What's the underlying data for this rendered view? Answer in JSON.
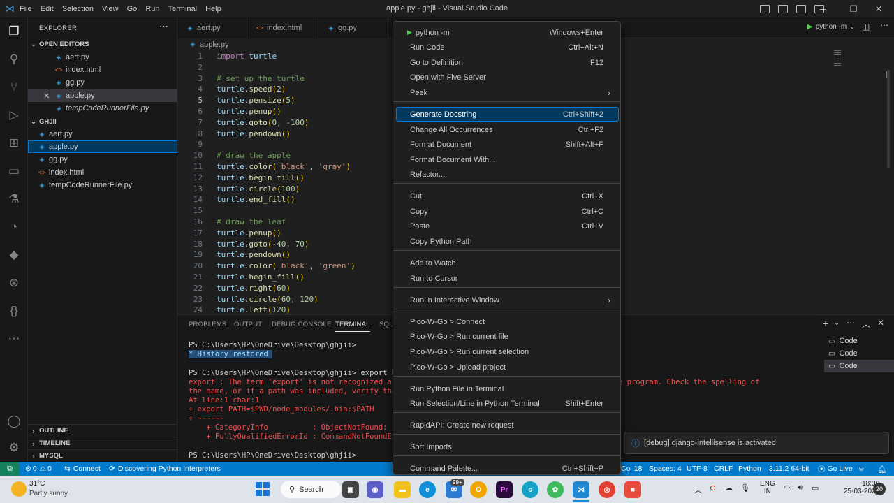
{
  "window": {
    "title": "apple.py - ghjii - Visual Studio Code",
    "menu": [
      "File",
      "Edit",
      "Selection",
      "View",
      "Go",
      "Run",
      "Terminal",
      "Help"
    ]
  },
  "sidebar": {
    "header": "EXPLORER",
    "open_editors_label": "OPEN EDITORS",
    "open_editors": [
      {
        "name": "aert.py",
        "type": "py"
      },
      {
        "name": "index.html",
        "type": "html"
      },
      {
        "name": "gg.py",
        "type": "py"
      },
      {
        "name": "apple.py",
        "type": "py"
      },
      {
        "name": "tempCodeRunnerFile.py",
        "type": "py"
      }
    ],
    "folder_label": "GHJII",
    "files": [
      {
        "name": "aert.py",
        "type": "py"
      },
      {
        "name": "apple.py",
        "type": "py"
      },
      {
        "name": "gg.py",
        "type": "py"
      },
      {
        "name": "index.html",
        "type": "html"
      },
      {
        "name": "tempCodeRunnerFile.py",
        "type": "py"
      }
    ],
    "outline_label": "OUTLINE",
    "timeline_label": "TIMELINE",
    "mysql_label": "MYSQL"
  },
  "tabs": [
    {
      "label": "aert.py",
      "type": "py"
    },
    {
      "label": "index.html",
      "type": "html"
    },
    {
      "label": "gg.py",
      "type": "py"
    }
  ],
  "run_label": "python -m",
  "breadcrumb": "apple.py",
  "code_lines": [
    {
      "n": "1",
      "t": "import turtle"
    },
    {
      "n": "2",
      "t": ""
    },
    {
      "n": "3",
      "t": "# set up the turtle"
    },
    {
      "n": "4",
      "t": "turtle.speed(2)"
    },
    {
      "n": "5",
      "t": "turtle.pensize(5)"
    },
    {
      "n": "6",
      "t": "turtle.penup()"
    },
    {
      "n": "7",
      "t": "turtle.goto(0, -100)"
    },
    {
      "n": "8",
      "t": "turtle.pendown()"
    },
    {
      "n": "9",
      "t": ""
    },
    {
      "n": "10",
      "t": "# draw the apple"
    },
    {
      "n": "11",
      "t": "turtle.color('black', 'gray')"
    },
    {
      "n": "12",
      "t": "turtle.begin_fill()"
    },
    {
      "n": "13",
      "t": "turtle.circle(100)"
    },
    {
      "n": "14",
      "t": "turtle.end_fill()"
    },
    {
      "n": "15",
      "t": ""
    },
    {
      "n": "16",
      "t": "# draw the leaf"
    },
    {
      "n": "17",
      "t": "turtle.penup()"
    },
    {
      "n": "18",
      "t": "turtle.goto(-40, 70)"
    },
    {
      "n": "19",
      "t": "turtle.pendown()"
    },
    {
      "n": "20",
      "t": "turtle.color('black', 'green')"
    },
    {
      "n": "21",
      "t": "turtle.begin_fill()"
    },
    {
      "n": "22",
      "t": "turtle.right(60)"
    },
    {
      "n": "23",
      "t": "turtle.circle(60, 120)"
    },
    {
      "n": "24",
      "t": "turtle.left(120)"
    }
  ],
  "panel": {
    "tabs": [
      "PROBLEMS",
      "OUTPUT",
      "DEBUG CONSOLE",
      "TERMINAL",
      "SQL"
    ],
    "active_tab": "TERMINAL",
    "terminal": {
      "prompt1": "PS C:\\Users\\HP\\OneDrive\\Desktop\\ghjii>",
      "history": " History restored ",
      "prompt2": "PS C:\\Users\\HP\\OneDrive\\Desktop\\ghjii> export PAT",
      "err1": "export : The term 'export' is not recognized as t",
      "err1b": "e program. Check the spelling of",
      "err2": "the name, or if a path was included, verify that",
      "err3": "At line:1 char:1",
      "err4": "+ export PATH=$PWD/node_modules/.bin:$PATH",
      "err5": "+ ~~~~~~",
      "err6": "    + CategoryInfo          : ObjectNotFound: (ex",
      "err7": "    + FullyQualifiedErrorId : CommandNotFoundExce",
      "prompt3": "PS C:\\Users\\HP\\OneDrive\\Desktop\\ghjii>"
    },
    "terminals": [
      "Code",
      "Code",
      "Code"
    ]
  },
  "context_menu": [
    {
      "label": "python -m",
      "key": "Windows+Enter"
    },
    {
      "label": "Run Code",
      "key": "Ctrl+Alt+N"
    },
    {
      "label": "Go to Definition",
      "key": "F12"
    },
    {
      "label": "Open with Five Server",
      "key": ""
    },
    {
      "label": "Peek",
      "key": ""
    },
    {
      "label": "Generate Docstring",
      "key": "Ctrl+Shift+2"
    },
    {
      "label": "Change All Occurrences",
      "key": "Ctrl+F2"
    },
    {
      "label": "Format Document",
      "key": "Shift+Alt+F"
    },
    {
      "label": "Format Document With...",
      "key": ""
    },
    {
      "label": "Refactor...",
      "key": ""
    },
    {
      "label": "Cut",
      "key": "Ctrl+X"
    },
    {
      "label": "Copy",
      "key": "Ctrl+C"
    },
    {
      "label": "Paste",
      "key": "Ctrl+V"
    },
    {
      "label": "Copy Python Path",
      "key": ""
    },
    {
      "label": "Add to Watch",
      "key": ""
    },
    {
      "label": "Run to Cursor",
      "key": ""
    },
    {
      "label": "Run in Interactive Window",
      "key": ""
    },
    {
      "label": "Pico-W-Go > Connect",
      "key": ""
    },
    {
      "label": "Pico-W-Go > Run current file",
      "key": ""
    },
    {
      "label": "Pico-W-Go > Run current selection",
      "key": ""
    },
    {
      "label": "Pico-W-Go > Upload project",
      "key": ""
    },
    {
      "label": "Run Python File in Terminal",
      "key": ""
    },
    {
      "label": "Run Selection/Line in Python Terminal",
      "key": "Shift+Enter"
    },
    {
      "label": "RapidAPI: Create new request",
      "key": ""
    },
    {
      "label": "Sort Imports",
      "key": ""
    },
    {
      "label": "Command Palette...",
      "key": "Ctrl+Shift+P"
    }
  ],
  "notification": "[debug] django-intellisense is activated",
  "status": {
    "errors": "0",
    "warnings": "0",
    "connect": "Connect",
    "discovering": "Discovering Python Interpreters",
    "col": "Col 18",
    "spaces": "Spaces: 4",
    "encoding": "UTF-8",
    "eol": "CRLF",
    "lang": "Python",
    "interpreter": "3.11.2 64-bit",
    "golive": "Go Live"
  },
  "taskbar": {
    "temp": "31°C",
    "weather": "Partly sunny",
    "search": "Search",
    "badge": "99+",
    "lang1": "ENG",
    "lang2": "IN",
    "time": "18:30",
    "date": "25-03-2023",
    "notif_count": "20"
  }
}
